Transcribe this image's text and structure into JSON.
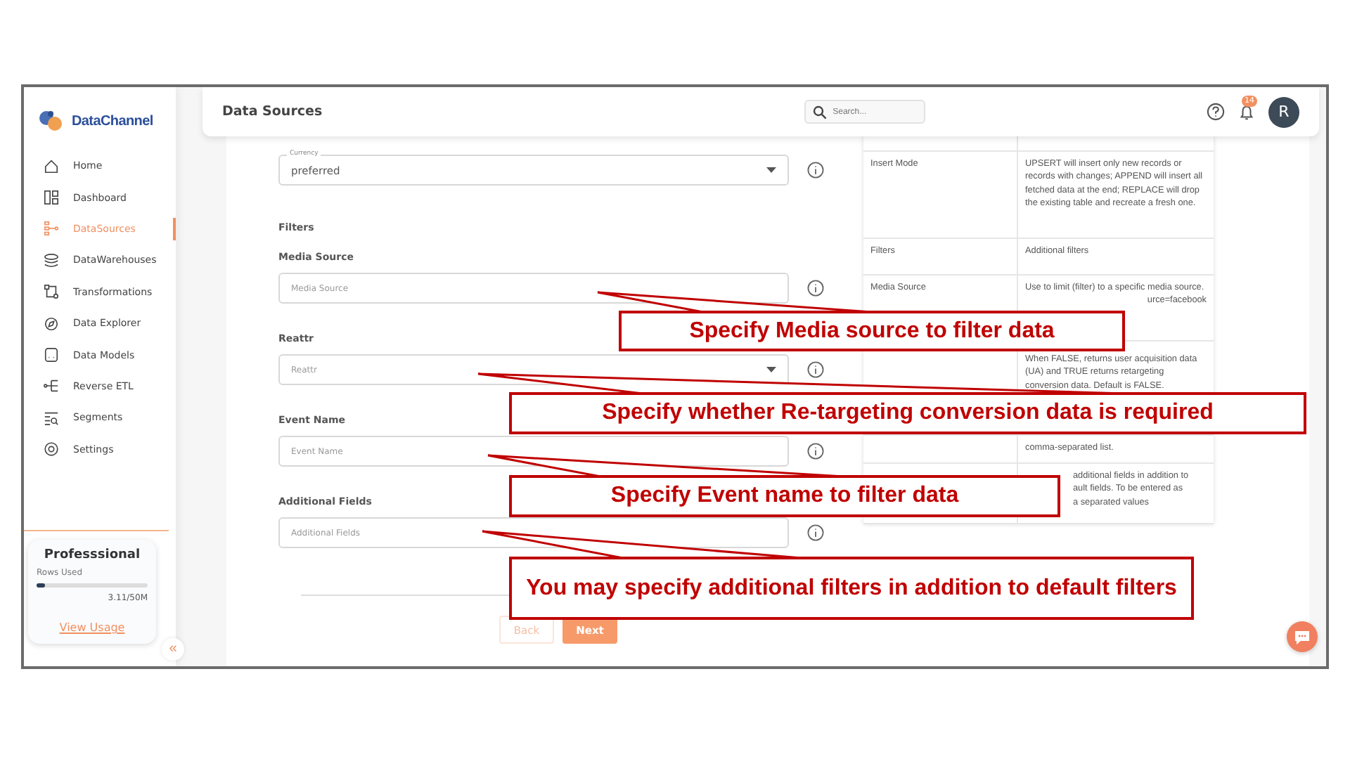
{
  "brand": {
    "name": "Data**Channel**"
  },
  "sidebar": {
    "items": [
      {
        "label": "Home",
        "selected": false
      },
      {
        "label": "Dashboard",
        "selected": false
      },
      {
        "label": "DataSources",
        "selected": true
      },
      {
        "label": "DataWarehouses",
        "selected": false
      },
      {
        "label": "Transformations",
        "selected": false
      },
      {
        "label": "Data Explorer",
        "selected": false
      },
      {
        "label": "Data Models",
        "selected": false
      },
      {
        "label": "Reverse ETL",
        "selected": false
      },
      {
        "label": "Segments",
        "selected": false
      },
      {
        "label": "Settings",
        "selected": false
      }
    ],
    "plan": {
      "title": "Professsional",
      "usage_label": "Rows Used",
      "level": 0.07,
      "reading": "3.11/50M",
      "link": "View Usage"
    },
    "collapse": "«"
  },
  "header": {
    "title": "Data Sources",
    "search_placeholder": "Search...",
    "notifications": "14",
    "avatar": "R"
  },
  "form": {
    "fields": [
      {
        "kind": "select",
        "floating_label": "Currency",
        "value": "preferred"
      },
      {
        "kind": "heading",
        "label": "Filters"
      },
      {
        "kind": "text",
        "label": "Media Source",
        "placeholder": "Media Source"
      },
      {
        "kind": "select",
        "label": "Reattr",
        "placeholder": "Reattr"
      },
      {
        "kind": "text",
        "label": "Event Name",
        "placeholder": "Event Name"
      },
      {
        "kind": "text",
        "label": "Additional Fields",
        "placeholder": "Additional Fields"
      }
    ],
    "buttons": [
      {
        "label": "Back",
        "kind": "secondary"
      },
      {
        "label": "Next",
        "kind": "primary"
      }
    ]
  },
  "table": {
    "rows": [
      {
        "param": "",
        "lines": []
      },
      {
        "param": "Insert Mode",
        "lines": [
          "UPSERT will insert only new records or records with changes; APPEND will insert all fetched data at the end; REPLACE will drop the existing table and recreate a fresh one."
        ]
      },
      {
        "param": "Filters",
        "lines": [
          "Additional filters"
        ]
      },
      {
        "param": "Media Source",
        "lines": [
          "Use to limit (filter) to a specific media source."
        ],
        "cut_line": "urce=facebook"
      },
      {
        "param": "",
        "lines": [
          "When FALSE, returns user acquisition data (UA) and TRUE returns retargeting conversion data. Default is FALSE."
        ]
      },
      {
        "param": "",
        "lines": [
          "comma-separated list."
        ]
      },
      {
        "param": "",
        "lines": [
          "additional fields in addition to",
          "ault fields. To be entered as",
          "a separated values"
        ]
      }
    ]
  },
  "callouts": [
    {
      "text": "Specify Media source to filter data"
    },
    {
      "text": "Specify whether Re-targeting conversion data is required"
    },
    {
      "text": "Specify Event name to filter data"
    },
    {
      "text": "You may specify additional filters in addition to default filters"
    }
  ]
}
